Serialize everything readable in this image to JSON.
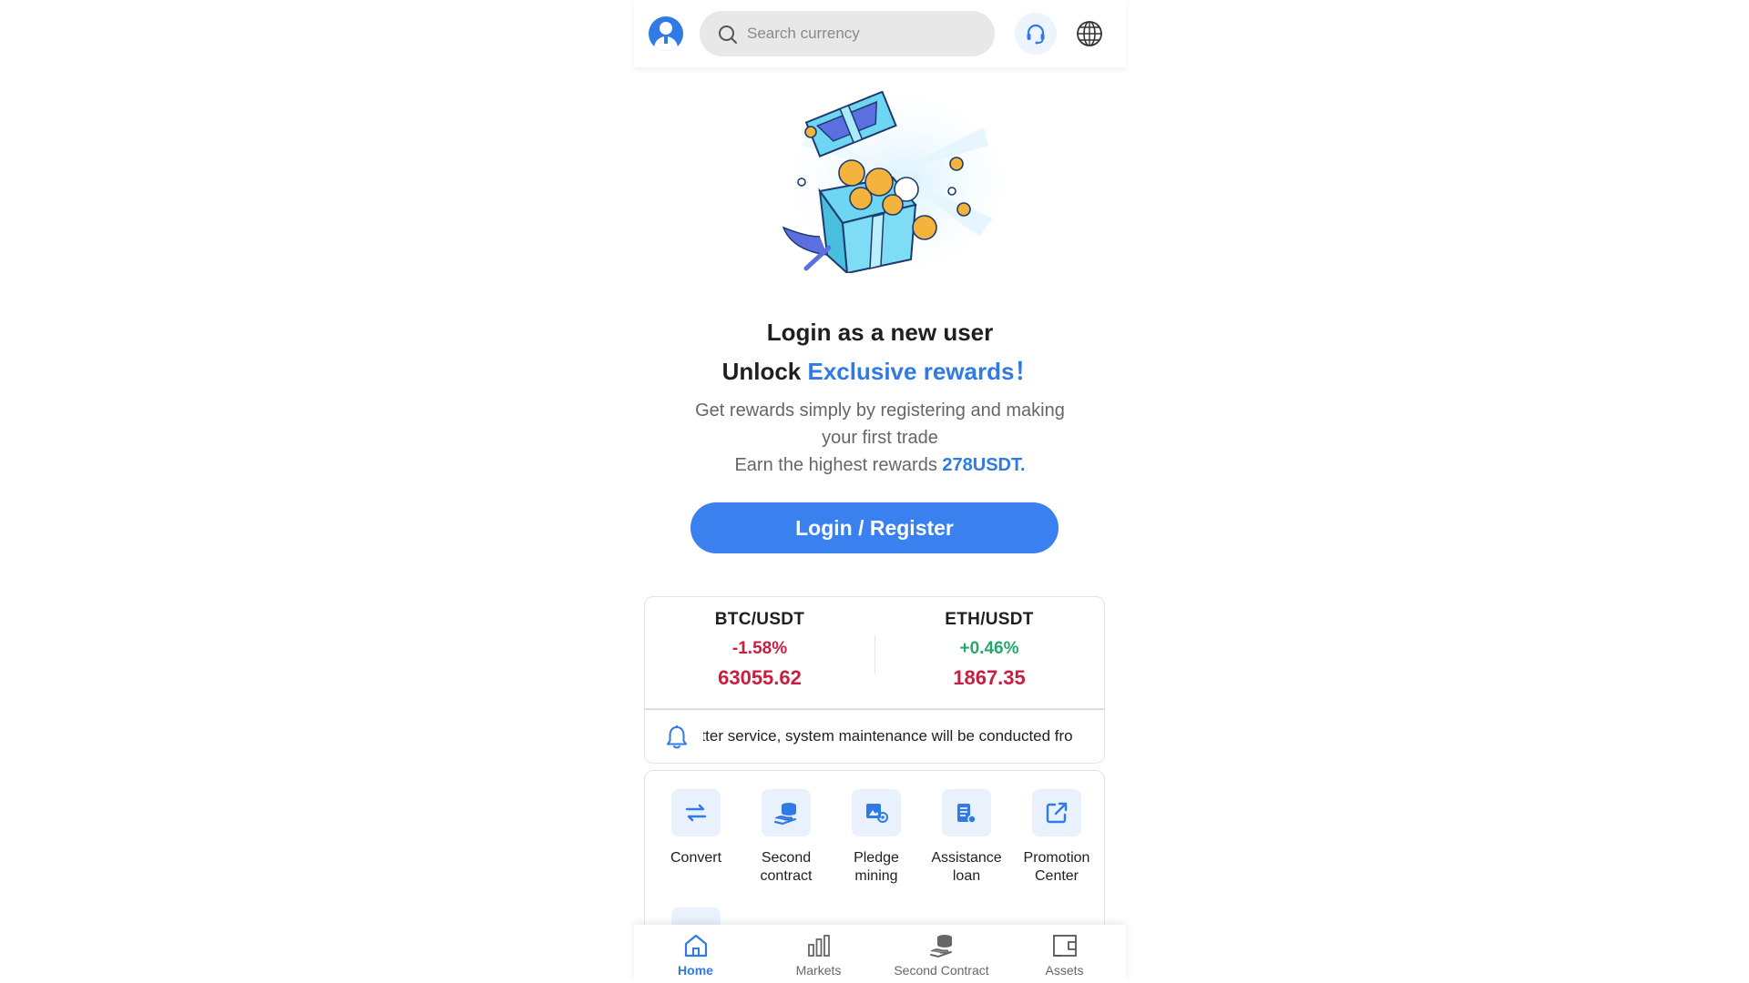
{
  "header": {
    "search_placeholder": "Search currency",
    "avatar_icon": "user-avatar-icon",
    "support_icon": "headset-icon",
    "language_icon": "globe-icon"
  },
  "hero": {
    "title_line1": "Login as a new user",
    "title_line2_prefix": "Unlock ",
    "title_line2_accent": "Exclusive rewards！",
    "description": "Get rewards simply by registering and making your first trade",
    "earn_prefix": "Earn the highest rewards ",
    "earn_amount": "278USDT.",
    "login_button": "Login / Register"
  },
  "tickers": [
    {
      "pair": "BTC/USDT",
      "change": "-1.58%",
      "price": "63055.62",
      "direction": "down"
    },
    {
      "pair": "ETH/USDT",
      "change": "+0.46%",
      "price": "1867.35",
      "direction": "up"
    }
  ],
  "notice": {
    "message": "etter service, system maintenance will be conducted fro",
    "icon": "bell-icon"
  },
  "features": [
    {
      "label": "Convert",
      "icon": "convert-icon"
    },
    {
      "label": "Second contract",
      "icon": "second-contract-icon"
    },
    {
      "label": "Pledge mining",
      "icon": "pledge-mining-icon"
    },
    {
      "label": "Assistance loan",
      "icon": "loan-icon"
    },
    {
      "label": "Promotion Center",
      "icon": "promotion-icon"
    }
  ],
  "bottom_nav": [
    {
      "label": "Home",
      "icon": "home-icon",
      "active": true
    },
    {
      "label": "Markets",
      "icon": "markets-icon",
      "active": false
    },
    {
      "label": "Second Contract",
      "icon": "second-contract-icon",
      "active": false
    },
    {
      "label": "Assets",
      "icon": "wallet-icon",
      "active": false
    }
  ],
  "colors": {
    "accent": "#2f7ae5",
    "button": "#3a80ef",
    "down": "#c81e3f",
    "up": "#26a86a"
  }
}
